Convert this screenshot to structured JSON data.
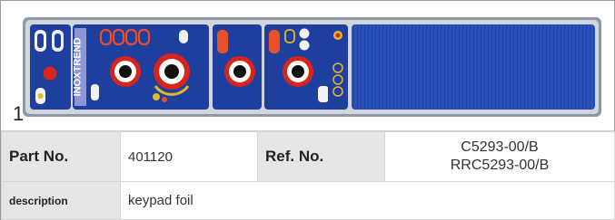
{
  "figure": {
    "item_number": "1",
    "brand_text": "INOXTREND"
  },
  "spec": {
    "part_no_label": "Part No.",
    "part_no_value": "401120",
    "ref_no_label": "Ref. No.",
    "ref_no_values": [
      "C5293-00/B",
      "RRC5293-00/B"
    ],
    "description_label": "description",
    "description_value": "keypad foil"
  },
  "colors": {
    "foil_blue": "#1e3f9e",
    "foil_dark_blue": "#0f2a78",
    "knob_red": "#d8241b",
    "window_orange": "#e8502a",
    "label_gray": "#e6e6e6"
  }
}
